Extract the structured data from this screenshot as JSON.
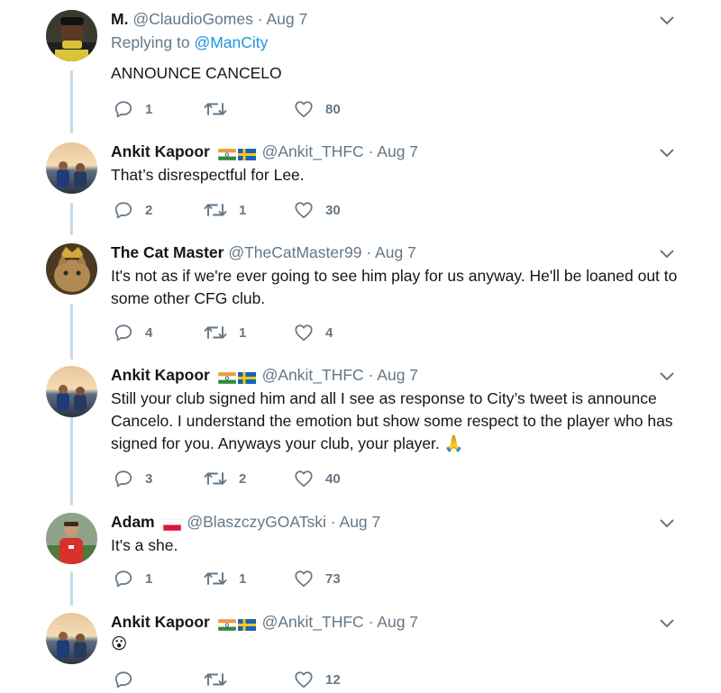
{
  "tweets": [
    {
      "name": "M.",
      "handle": "@ClaudioGomes",
      "sep": "·",
      "date": "Aug 7",
      "replying_prefix": "Replying to",
      "replying_to": "@ManCity",
      "text": "ANNOUNCE CANCELO",
      "replies": "1",
      "retweets": "",
      "likes": "80",
      "flags": []
    },
    {
      "name": "Ankit Kapoor",
      "handle": "@Ankit_THFC",
      "sep": "·",
      "date": "Aug 7",
      "text": "That’s disrespectful for Lee.",
      "replies": "2",
      "retweets": "1",
      "likes": "30",
      "flags": [
        "india-flag-icon",
        "sweden-flag-icon"
      ]
    },
    {
      "name": "The Cat Master",
      "handle": "@TheCatMaster99",
      "sep": "·",
      "date": "Aug 7",
      "text": "It's not as if we're ever going to see him play for us anyway. He'll be loaned out to some other CFG club.",
      "replies": "4",
      "retweets": "1",
      "likes": "4",
      "flags": []
    },
    {
      "name": "Ankit Kapoor",
      "handle": "@Ankit_THFC",
      "sep": "·",
      "date": "Aug 7",
      "text": "Still your club signed him and all I see as response to City’s tweet is announce Cancelo. I understand the emotion but show some respect to the player who has signed for you. Anyways your club, your player. 🙏",
      "replies": "3",
      "retweets": "2",
      "likes": "40",
      "flags": [
        "india-flag-icon",
        "sweden-flag-icon"
      ]
    },
    {
      "name": "Adam",
      "handle": "@BlaszczyGOATski",
      "sep": "·",
      "date": "Aug 7",
      "text": "It's a she.",
      "replies": "1",
      "retweets": "1",
      "likes": "73",
      "flags": [
        "poland-flag-icon"
      ]
    },
    {
      "name": "Ankit Kapoor",
      "handle": "@Ankit_THFC",
      "sep": "·",
      "date": "Aug 7",
      "text": "😮",
      "replies": "",
      "retweets": "",
      "likes": "12",
      "flags": [
        "india-flag-icon",
        "sweden-flag-icon"
      ]
    }
  ],
  "colors": {
    "text": "#14171a",
    "muted": "#657786",
    "link": "#1b95e0",
    "thread_line": "#c6d9e6"
  },
  "icons": {
    "reply": "reply-icon",
    "retweet": "retweet-icon",
    "like": "heart-icon",
    "more": "chevron-down-icon"
  }
}
